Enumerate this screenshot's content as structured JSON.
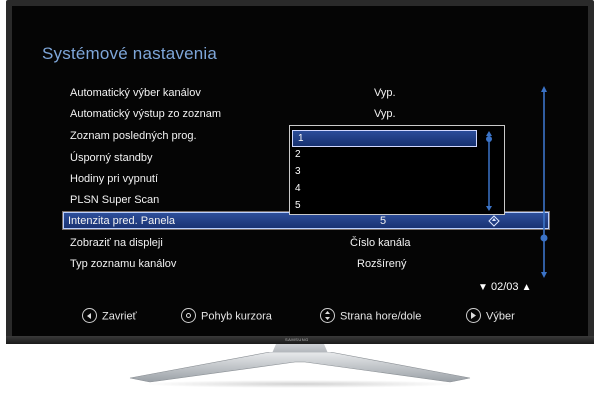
{
  "menu": {
    "title": "Systémové nastavenia",
    "rows": [
      {
        "label": "Automatický výber kanálov",
        "value": "Vyp."
      },
      {
        "label": "Automatický výstup zo zoznam",
        "value": "Vyp."
      },
      {
        "label": "Zoznam posledných prog.",
        "value": ""
      },
      {
        "label": "Úsporný standby",
        "value": ""
      },
      {
        "label": "Hodiny pri vypnutí",
        "value": ""
      },
      {
        "label": "PLSN Super Scan",
        "value": ""
      },
      {
        "label": "Intenzita pred. Panela",
        "value": "5"
      },
      {
        "label": "Zobraziť na displeji",
        "value": "Číslo kanála"
      },
      {
        "label": "Typ zoznamu kanálov",
        "value": "Rozšírený"
      }
    ],
    "active_row_index": 6
  },
  "dropdown": {
    "options": [
      "1",
      "2",
      "3",
      "4",
      "5"
    ],
    "selected": "1"
  },
  "pagination": {
    "text": "02/03"
  },
  "footer": {
    "close_label": "Zavrieť",
    "cursor_label": "Pohyb kurzora",
    "page_label": "Strana hore/dole",
    "select_label": "Výber"
  },
  "tv": {
    "brand": "SAMSUNG"
  },
  "colors": {
    "title": "#7ea6d9",
    "highlight": "#2e4f9a",
    "scrollbar": "#3b73c7"
  }
}
